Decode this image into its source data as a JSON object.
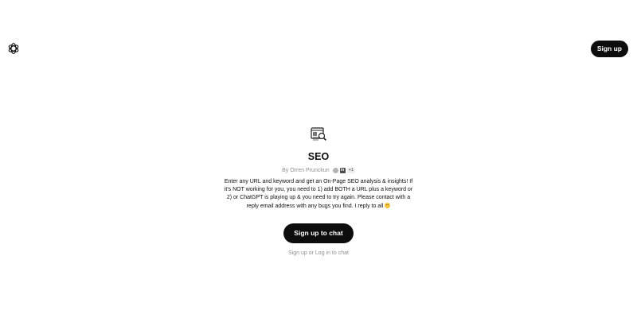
{
  "header": {
    "logo_icon": "openai-logo-icon",
    "signup_label": "Sign up"
  },
  "gpt": {
    "icon": "seo-document-magnifier-icon",
    "title": "SEO",
    "author": "By Orren Prunckun",
    "links_badge": "+1",
    "linkedin_label": "in",
    "description": "Enter any URL and keyword and get an On-Page SEO analysis & insights! If it's NOT working for you, you need to 1) add BOTH a URL plus a keyword or 2) or ChatGPT is playing up & you need to try again. Please contact with a reply email address with any bugs you find. I reply to all",
    "emoji": "smiling-face-emoji"
  },
  "cta": {
    "chat_button": "Sign up to chat",
    "signup_link": "Sign up",
    "or_text": " or ",
    "login_link": "Log in",
    "suffix": " to chat"
  }
}
